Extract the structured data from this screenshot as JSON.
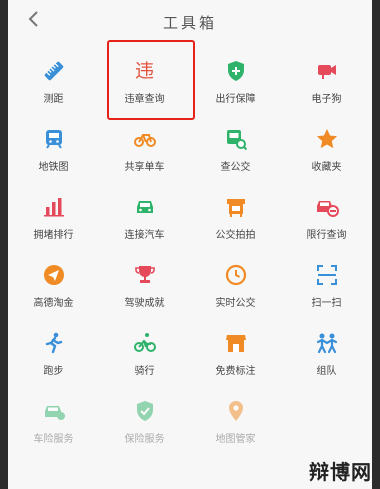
{
  "header": {
    "title": "工具箱",
    "back_icon": "chevron-left-icon"
  },
  "rows": [
    [
      {
        "label": "测距",
        "icon": "ruler-icon",
        "color": "#3a8fd9"
      },
      {
        "label": "违章查询",
        "icon_text": "违",
        "color": "#e4553f"
      },
      {
        "label": "出行保障",
        "icon": "shield-plus-icon",
        "color": "#2fb36a"
      },
      {
        "label": "电子狗",
        "icon": "camera-icon",
        "color": "#e44a5a"
      }
    ],
    [
      {
        "label": "地铁图",
        "icon": "subway-icon",
        "color": "#3a8fd9"
      },
      {
        "label": "共享单车",
        "icon": "bicycle-icon",
        "color": "#f08a24"
      },
      {
        "label": "查公交",
        "icon": "bus-search-icon",
        "color": "#2fb36a"
      },
      {
        "label": "收藏夹",
        "icon": "star-icon",
        "color": "#f08a24"
      }
    ],
    [
      {
        "label": "拥堵排行",
        "icon": "bar-chart-icon",
        "color": "#e44a5a"
      },
      {
        "label": "连接汽车",
        "icon": "car-icon",
        "color": "#2fb36a"
      },
      {
        "label": "公交拍拍",
        "icon": "bus-stop-icon",
        "color": "#f08a24"
      },
      {
        "label": "限行查询",
        "icon": "car-restricted-icon",
        "color": "#e44a5a"
      }
    ],
    [
      {
        "label": "高德淘金",
        "icon": "send-icon",
        "color": "#f08a24"
      },
      {
        "label": "驾驶成就",
        "icon": "trophy-icon",
        "color": "#e44a5a"
      },
      {
        "label": "实时公交",
        "icon": "clock-icon",
        "color": "#f08a24"
      },
      {
        "label": "扫一扫",
        "icon": "scan-icon",
        "color": "#3a8fd9"
      }
    ],
    [
      {
        "label": "跑步",
        "icon": "runner-icon",
        "color": "#3a8fd9"
      },
      {
        "label": "骑行",
        "icon": "cyclist-icon",
        "color": "#2fb36a"
      },
      {
        "label": "免费标注",
        "icon": "shop-icon",
        "color": "#f08a24"
      },
      {
        "label": "组队",
        "icon": "team-icon",
        "color": "#3a8fd9"
      }
    ],
    [
      {
        "label": "车险服务",
        "icon": "car-insurance-icon",
        "color": "#2fb36a"
      },
      {
        "label": "保险服务",
        "icon": "shield-icon",
        "color": "#2fb36a"
      },
      {
        "label": "地图管家",
        "icon": "location-pin-icon",
        "color": "#f08a24"
      },
      {
        "label": "",
        "icon": "",
        "color": ""
      }
    ]
  ],
  "watermark": "辩博网"
}
